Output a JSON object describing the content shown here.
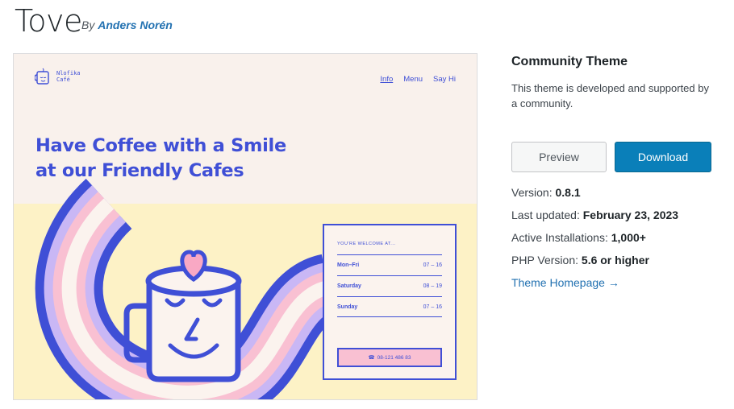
{
  "theme": {
    "title": "Tove",
    "by_prefix": "By",
    "author": "Anders Norén"
  },
  "preview": {
    "brand_name": "Nlofika Café",
    "nav": [
      "Info",
      "Menu",
      "Say Hi"
    ],
    "hero_line1": "Have Coffee with a Smile",
    "hero_line2": "at our Friendly Cafes",
    "card": {
      "heading": "YOU'RE WELCOME AT...",
      "hours": [
        {
          "day": "Mon–Fri",
          "time": "07 – 16"
        },
        {
          "day": "Saturday",
          "time": "08 – 19"
        },
        {
          "day": "Sunday",
          "time": "07 – 16"
        }
      ],
      "phone": "08-121 486 83"
    },
    "colors": {
      "accent": "#3f4fd6",
      "pink": "#f9c0d2",
      "lavender": "#c9b7f5",
      "cream": "#fdf2c6"
    }
  },
  "sidebar": {
    "title": "Community Theme",
    "description": "This theme is developed and supported by a community.",
    "preview_label": "Preview",
    "download_label": "Download",
    "version_label": "Version:",
    "version": "0.8.1",
    "updated_label": "Last updated:",
    "updated": "February 23, 2023",
    "installs_label": "Active Installations:",
    "installs": "1,000+",
    "php_label": "PHP Version:",
    "php": "5.6 or higher",
    "homepage_label": "Theme Homepage →"
  }
}
